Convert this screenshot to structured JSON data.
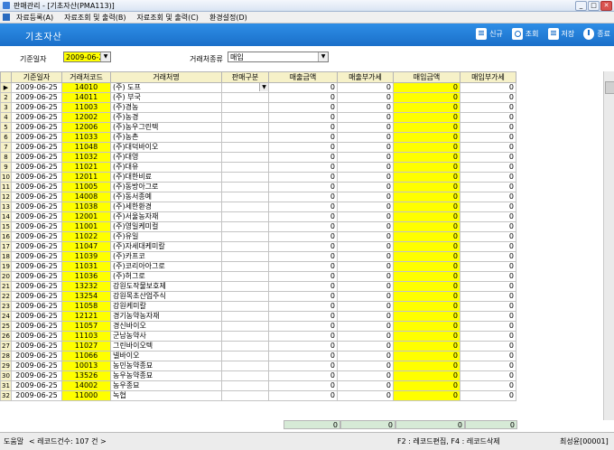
{
  "window": {
    "title": "판매관리 - [기초자산(PMA113)]",
    "min": "_",
    "max": "□",
    "close": "✕"
  },
  "menu": [
    "자료등록(A)",
    "자료조회 및 출력(B)",
    "자료조회 및 출력(C)",
    "환경설정(D)"
  ],
  "page_title": "기초자산",
  "toolbar": {
    "new_label": "신규",
    "search_label": "조회",
    "save_label": "저장",
    "exit_label": "종료"
  },
  "filter": {
    "date_label": "기준일자",
    "date_value": "2009-06-25",
    "type_label": "거래처종류",
    "type_value": "매입"
  },
  "columns": [
    "기준일자",
    "거래처코드",
    "거래처명",
    "판매구분",
    "매출금액",
    "매출부가세",
    "매입금액",
    "매입부가세"
  ],
  "rows": [
    [
      "1",
      "2009-06-25",
      "14010",
      "(주) 도프"
    ],
    [
      "2",
      "2009-06-25",
      "14011",
      "(주) 부국"
    ],
    [
      "3",
      "2009-06-25",
      "11003",
      "(주)경농"
    ],
    [
      "4",
      "2009-06-25",
      "12002",
      "(주)농경"
    ],
    [
      "5",
      "2009-06-25",
      "12006",
      "(주)농우그린텍"
    ],
    [
      "6",
      "2009-06-25",
      "11033",
      "(주)농촌"
    ],
    [
      "7",
      "2009-06-25",
      "11048",
      "(주)대덕바이오"
    ],
    [
      "8",
      "2009-06-25",
      "11032",
      "(주)대영"
    ],
    [
      "9",
      "2009-06-25",
      "11021",
      "(주)대유"
    ],
    [
      "10",
      "2009-06-25",
      "12011",
      "(주)대한비료"
    ],
    [
      "11",
      "2009-06-25",
      "11005",
      "(주)동방아그로"
    ],
    [
      "12",
      "2009-06-25",
      "14008",
      "(주)동서종예"
    ],
    [
      "13",
      "2009-06-25",
      "11038",
      "(주)세한환경"
    ],
    [
      "14",
      "2009-06-25",
      "12001",
      "(주)서울농자재"
    ],
    [
      "15",
      "2009-06-25",
      "11001",
      "(주)영일케미컬"
    ],
    [
      "16",
      "2009-06-25",
      "11022",
      "(주)유일"
    ],
    [
      "17",
      "2009-06-25",
      "11047",
      "(주)자세대케미칼"
    ],
    [
      "18",
      "2009-06-25",
      "11039",
      "(주)카프코"
    ],
    [
      "19",
      "2009-06-25",
      "11031",
      "(주)코리아아그로"
    ],
    [
      "20",
      "2009-06-25",
      "11036",
      "(주)허그로"
    ],
    [
      "21",
      "2009-06-25",
      "13232",
      "강원도작물보호제"
    ],
    [
      "22",
      "2009-06-25",
      "13254",
      "강원목초산업주식"
    ],
    [
      "23",
      "2009-06-25",
      "11058",
      "강원케미칼"
    ],
    [
      "24",
      "2009-06-25",
      "12121",
      "경기농약농자재"
    ],
    [
      "25",
      "2009-06-25",
      "11057",
      "경신바이오"
    ],
    [
      "26",
      "2009-06-25",
      "11103",
      "군남농약사"
    ],
    [
      "27",
      "2009-06-25",
      "11027",
      "그린바이오텍"
    ],
    [
      "28",
      "2009-06-25",
      "11066",
      "넬바이오"
    ],
    [
      "29",
      "2009-06-25",
      "10013",
      "농민농약종묘"
    ],
    [
      "30",
      "2009-06-25",
      "13526",
      "농우농약종묘"
    ],
    [
      "31",
      "2009-06-25",
      "14002",
      "농우종묘"
    ],
    [
      "32",
      "2009-06-25",
      "11000",
      "녹협"
    ]
  ],
  "zero": "0",
  "totals": [
    "0",
    "0",
    "0",
    "0"
  ],
  "status": {
    "mode": "도움말",
    "count": "< 레코드건수: 107 건 >",
    "keys": "F2 : 레코드편집, F4 : 레코드삭제",
    "user": "최성윤[00001]"
  }
}
